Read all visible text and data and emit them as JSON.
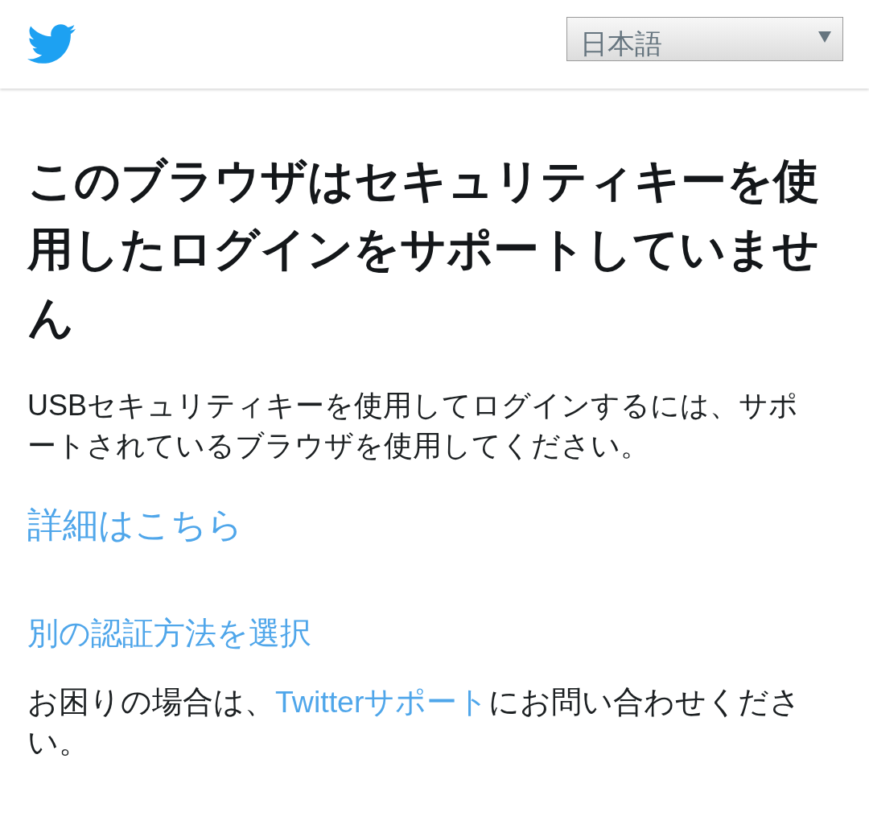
{
  "header": {
    "language_select": {
      "value": "日本語"
    }
  },
  "heading": "このブラウザはセキュリティキーを使用したログインをサポートしていません",
  "description": "USBセキュリティキーを使用してログインするには、サポートされているブラウザを使用してください。",
  "learn_more_link": "詳細はこちら",
  "alternative_method_link": "別の認証方法を選択",
  "help_text": {
    "before": "お困りの場合は、",
    "link": "Twitterサポート",
    "after": "にお問い合わせください。"
  }
}
